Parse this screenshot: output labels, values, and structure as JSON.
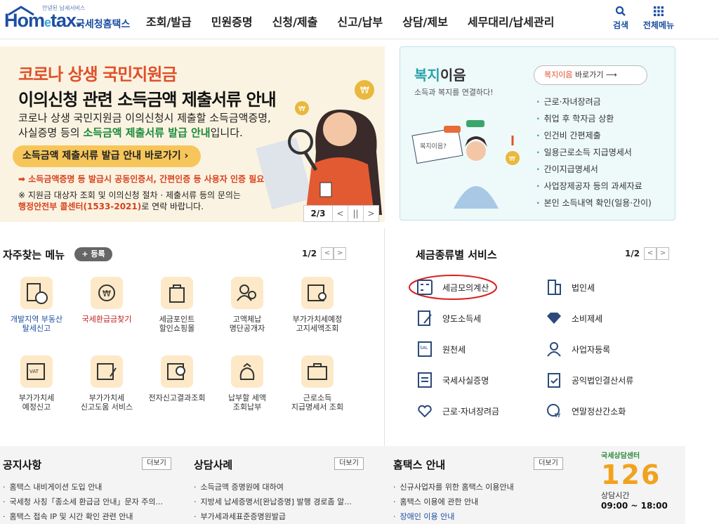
{
  "header": {
    "logo_sub": "안녕된 납세서비스",
    "logo_main_a": "Hom",
    "logo_main_e": "e",
    "logo_main_b": "tax.",
    "logo_kr": "국세청홈택스",
    "nav": [
      "조회/발급",
      "민원증명",
      "신청/제출",
      "신고/납부",
      "상담/제보",
      "세무대리/납세관리"
    ],
    "search_label": "검색",
    "all_menu_label": "전체메뉴"
  },
  "banner": {
    "line1": "코로나 상생 국민지원금",
    "line2": "이의신청 관련 소득금액 제출서류 안내",
    "line3_a": "코로나 상생 국민지원금 이의신청시 제출할 소득금액증명,",
    "line3_b": "사실증명 등의 ",
    "line3_hl": "소득금액 제출서류 발급 안내",
    "line3_c": "입니다.",
    "button": "소득금액 제출서류 발급 안내 바로가기",
    "note1": "소득금액증명 등 발급시 공동인증서, 간편인증 등 사용자 인증 필요",
    "note2_a": "※ 지원금 대상자 조회 및 이의신청 절차 · 제출서류 등의 문의는",
    "note2_red": "행정안전부 콜센터(1533-2021)",
    "note2_b": "로 연락 바랍니다.",
    "page": "2/3",
    "prev": "<",
    "pause": "||",
    "next": ">"
  },
  "welfare": {
    "title_a": "복지",
    "title_b": "이음",
    "subtitle": "소득과 복지를 연결하다!",
    "button_a": "복지이음",
    "button_b": " 바로가기",
    "items": [
      "근로·자녀장려금",
      "취업 후 학자금 상환",
      "인건비 간편제출",
      "일용근로소득 지급명세서",
      "간이지급명세서",
      "사업장제공자 등의 과세자료",
      "본인 소득내역 확인(일용·간이)"
    ]
  },
  "favorites": {
    "title": "자주찾는 메뉴",
    "register": "+ 등록",
    "page": "1/2",
    "tiles": [
      "개발지역 부동산\n탈세신고",
      "국세환급금찾기",
      "세금포인트\n할인쇼핑몰",
      "고액체납\n명단공개자",
      "부가가치세예정\n고지세액조회",
      "부가가치세\n예정신고",
      "부가가치세\n신고도움 서비스",
      "전자신고결과조회",
      "납부할 세액\n조회납부",
      "근로소득\n지급명세서 조회"
    ]
  },
  "tax_services": {
    "title": "세금종류별 서비스",
    "page": "1/2",
    "left": [
      "세금모의계산",
      "양도소득세",
      "원천세",
      "국세사실증명",
      "근로·자녀장려금"
    ],
    "right": [
      "법인세",
      "소비제세",
      "사업자등록",
      "공익법인결산서류",
      "연말정산간소화"
    ]
  },
  "notice": {
    "title": "공지사항",
    "more": "더보기",
    "items": [
      "홈택스 내비게이션 도입 안내",
      "국세청 사칭「종소세 환급금 안내」문자 주의...",
      "홈택스 접속 IP 및 시간 확인 관련 안내"
    ]
  },
  "consult": {
    "title": "상담사례",
    "more": "더보기",
    "items": [
      "소득금액 증명원에 대하여",
      "지방세 납세증명서[완납증명] 발행 경로좀 알...",
      "부가세과세표준증명원발급"
    ]
  },
  "guide": {
    "title": "홈택스 안내",
    "more": "더보기",
    "items": [
      "신규사업자를 위한 홈택스 이용안내",
      "홈택스 이용에 관한 안내",
      "장애인 이용 안내"
    ]
  },
  "center": {
    "label": "국세상담센터",
    "number": "126",
    "hours_label": "상담시간",
    "hours": "09:00 ~ 18:00"
  },
  "colors": {
    "brand": "#1d4fa1",
    "accent_orange": "#e0502a",
    "teal": "#26a3a8",
    "highlight_circle": "#d9201f"
  }
}
